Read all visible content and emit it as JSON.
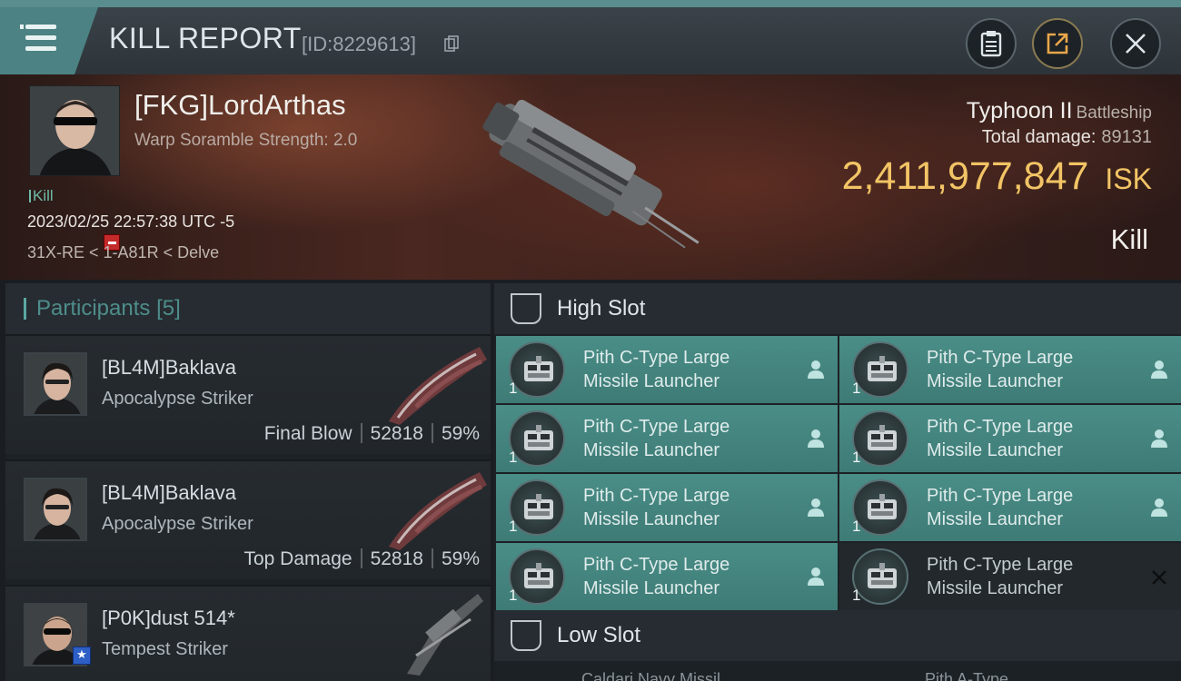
{
  "header": {
    "title": "KILL REPORT",
    "report_id": "[ID:8229613]",
    "buttons": [
      "menu",
      "clipboard",
      "share",
      "close"
    ]
  },
  "victim": {
    "name": "[FKG]LordArthas",
    "scramble": "Warp Soramble Strength: 2.0",
    "kill_tag": "Kill",
    "datetime": "2023/02/25 22:57:38 UTC -5",
    "location": "31X-RE < 1-A81R < Delve",
    "ship_name": "Typhoon II",
    "ship_class": "Battleship",
    "total_damage_label": "Total damage:",
    "total_damage": "89131",
    "isk_value": "2,411,977,847",
    "isk_unit": "ISK",
    "result": "Kill"
  },
  "participants": {
    "label": "Participants",
    "count": "[5]",
    "items": [
      {
        "name": "[BL4M]Baklava",
        "ship": "Apocalypse Striker",
        "role": "Final Blow",
        "damage": "52818",
        "percent": "59%"
      },
      {
        "name": "[BL4M]Baklava",
        "ship": "Apocalypse Striker",
        "role": "Top Damage",
        "damage": "52818",
        "percent": "59%"
      },
      {
        "name": "[P0K]dust 514*",
        "ship": "Tempest Striker"
      }
    ]
  },
  "slots": {
    "high_label": "High Slot",
    "low_label": "Low Slot",
    "high": [
      {
        "name1": "Pith C-Type Large",
        "name2": "Missile Launcher",
        "qty": "1",
        "status": "dropped"
      },
      {
        "name1": "Pith C-Type Large",
        "name2": "Missile Launcher",
        "qty": "1",
        "status": "dropped"
      },
      {
        "name1": "Pith C-Type Large",
        "name2": "Missile Launcher",
        "qty": "1",
        "status": "dropped"
      },
      {
        "name1": "Pith C-Type Large",
        "name2": "Missile Launcher",
        "qty": "1",
        "status": "dropped"
      },
      {
        "name1": "Pith C-Type Large",
        "name2": "Missile Launcher",
        "qty": "1",
        "status": "dropped"
      },
      {
        "name1": "Pith C-Type Large",
        "name2": "Missile Launcher",
        "qty": "1",
        "status": "dropped"
      },
      {
        "name1": "Pith C-Type Large",
        "name2": "Missile Launcher",
        "qty": "1",
        "status": "dropped"
      },
      {
        "name1": "Pith C-Type Large",
        "name2": "Missile Launcher",
        "qty": "1",
        "status": "destroyed"
      }
    ],
    "low_peek": [
      "Caldari Navy Missil",
      "Pith A-Type"
    ]
  },
  "colors": {
    "accent": "#4c8283",
    "isk_gold": "#f2c465",
    "module_bg": "#4a8d87"
  }
}
